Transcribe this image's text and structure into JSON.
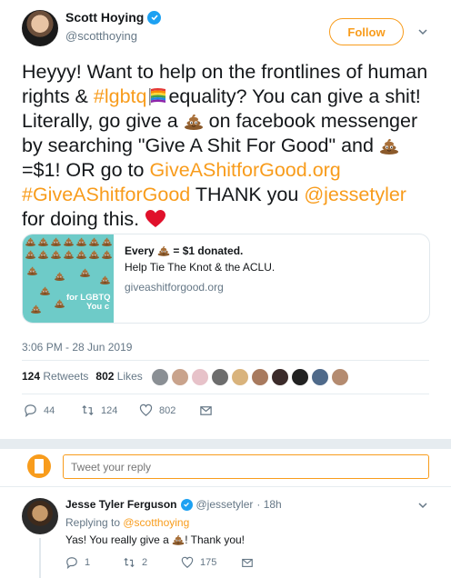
{
  "tweet": {
    "author_name": "Scott Hoying",
    "author_handle": "@scotthoying",
    "follow_label": "Follow",
    "text_parts": {
      "p1": "Heyyy! Want to help on the frontlines of human rights & ",
      "hashtag_lgbtq": "#lgbtq",
      "p2": "equality? You can give a shit! Literally, go give a ",
      "p3": " on facebook messenger by searching \"Give A Shit For Good\" and ",
      "p4": "=$1! OR go to ",
      "link_site": "GiveAShitforGood.org",
      "hashtag_give": "#GiveAShitforGood",
      "p5": " THANK you ",
      "mention": "@jessetyler",
      "p6": " for doing this. "
    },
    "card": {
      "title_prefix": "Every ",
      "title_suffix": " = $1 donated.",
      "description": "Help Tie The Knot & the ACLU.",
      "url": "giveashitforgood.org",
      "image_text_1": "for LGBTQ",
      "image_text_2": "You c"
    },
    "timestamp": "3:06 PM - 28 Jun 2019",
    "retweets_count": "124",
    "retweets_label": "Retweets",
    "likes_count": "802",
    "likes_label": "Likes",
    "actions": {
      "replies": "44",
      "retweets": "124",
      "likes": "802"
    }
  },
  "reply_box": {
    "placeholder": "Tweet your reply"
  },
  "reply_tweet": {
    "author_name": "Jesse Tyler Ferguson",
    "author_handle": "@jessetyler",
    "time": "· 18h",
    "replying_prefix": "Replying to ",
    "replying_to": "@scotthoying",
    "text_before": "Yas! You really give a ",
    "text_after": "! Thank you!",
    "actions": {
      "replies": "1",
      "retweets": "2",
      "likes": "175"
    }
  },
  "colors": {
    "accent": "#f89c1c",
    "verified": "#1da1f2",
    "muted": "#657786",
    "text": "#14171a"
  }
}
